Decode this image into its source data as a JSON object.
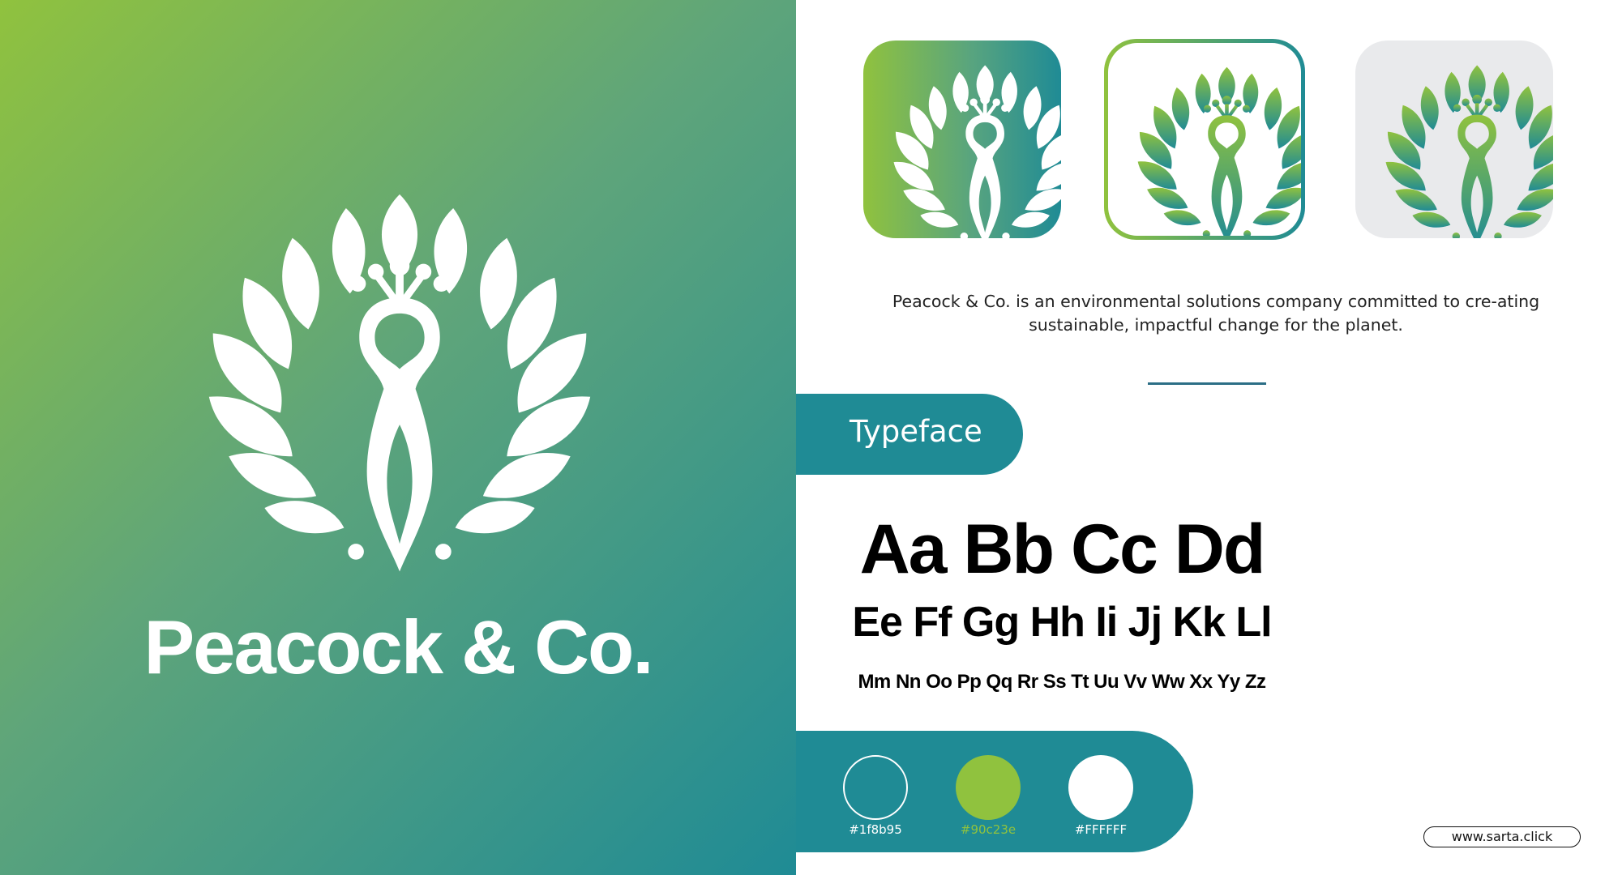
{
  "brand": {
    "name": "Peacock & Co.",
    "logo_icon": "peacock-icon"
  },
  "app_icons": [
    {
      "variant": "gradient-background",
      "icon": "peacock-icon",
      "fill": "#ffffff"
    },
    {
      "variant": "gradient-outline",
      "icon": "peacock-icon",
      "fill": "gradient"
    },
    {
      "variant": "grey-background",
      "icon": "peacock-icon",
      "fill": "gradient"
    }
  ],
  "description": "Peacock & Co. is an environmental solutions company committed to cre-ating sustainable, impactful change for the planet.",
  "typeface": {
    "label": "Typeface",
    "sample_large": "Aa Bb Cc Dd",
    "sample_medium": "Ee Ff Gg Hh Ii Jj Kk Ll",
    "sample_small": "Mm Nn Oo Pp Qq Rr Ss Tt Uu Vv Ww Xx Yy Zz"
  },
  "palette": [
    {
      "label": "#1f8b95",
      "color": "#1f8b95"
    },
    {
      "label": "#90c23e",
      "color": "#90c23e"
    },
    {
      "label": "#FFFFFF",
      "color": "#FFFFFF"
    }
  ],
  "website": "www.sarta.click",
  "colors": {
    "teal": "#1f8b95",
    "green": "#90c23e",
    "white": "#ffffff"
  }
}
